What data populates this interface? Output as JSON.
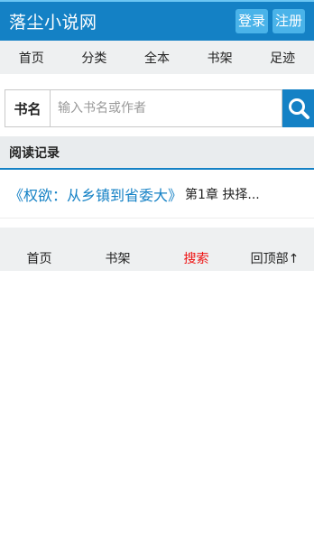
{
  "header": {
    "site_title": "落尘小说网",
    "login_label": "登录",
    "register_label": "注册"
  },
  "topnav": {
    "items": [
      "首页",
      "分类",
      "全本",
      "书架",
      "足迹"
    ]
  },
  "search": {
    "label": "书名",
    "placeholder": "输入书名或作者",
    "button_icon": "search-icon"
  },
  "history": {
    "heading": "阅读记录",
    "records": [
      {
        "title": "《权欲：从乡镇到省委大》",
        "chapter": "第1章 抉择..."
      }
    ]
  },
  "footnav": {
    "items": [
      "首页",
      "书架",
      "搜索",
      "回顶部↑"
    ],
    "active_index": 2
  },
  "colors": {
    "brand": "#1481c5",
    "button": "#4ab3e9",
    "active": "#ee1111"
  }
}
